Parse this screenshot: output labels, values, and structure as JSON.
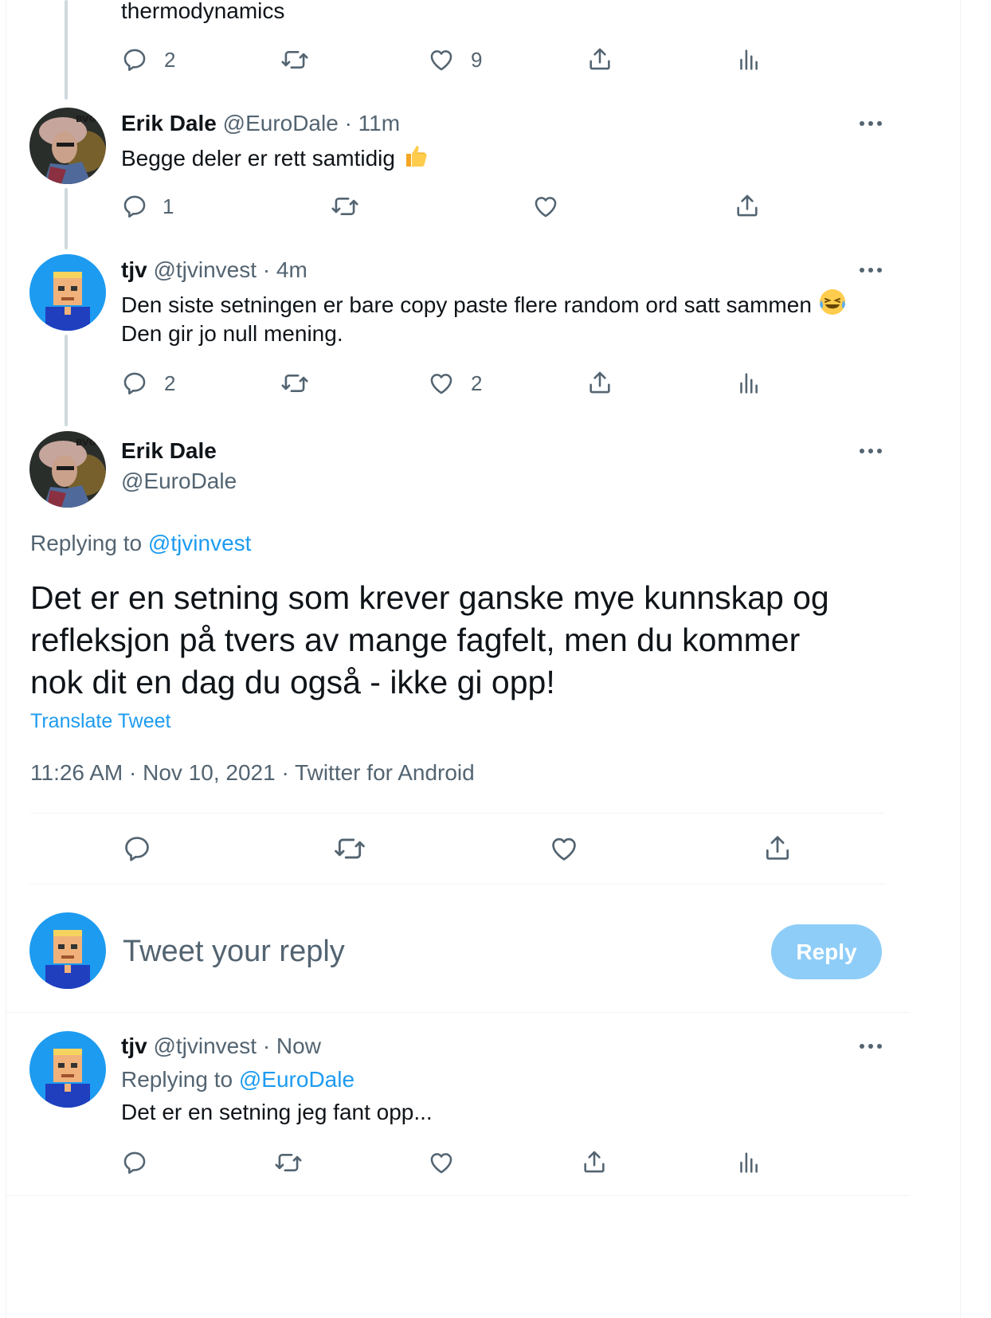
{
  "thread": {
    "prev_tweet": {
      "text_tail": "thermodynamics",
      "replies": "2",
      "likes": "9"
    },
    "tweet1": {
      "name": "Erik Dale",
      "handle": "@EuroDale",
      "time": "· 11m",
      "text": "Begge deler er rett samtidig",
      "replies": "1"
    },
    "tweet2": {
      "name": "tjv",
      "handle": "@tjvinvest",
      "time": "· 4m",
      "text_line1": "Den siste setningen er bare copy paste flere random ord satt sammen",
      "text_line2": "Den gir jo null mening.",
      "replies": "2",
      "likes": "2"
    }
  },
  "main_tweet": {
    "name": "Erik Dale",
    "handle": "@EuroDale",
    "replying_label": "Replying to",
    "replying_handle": "@tjvinvest",
    "text_line1": "Det er en setning som krever ganske mye kunnskap og",
    "text_line2": "refleksjon på tvers av mange fagfelt, men du kommer",
    "text_line3": "nok dit en dag du også - ikke gi opp!",
    "translate": "Translate Tweet",
    "meta": "11:26 AM · Nov 10, 2021 · Twitter for Android"
  },
  "composer": {
    "placeholder": "Tweet your reply",
    "button": "Reply"
  },
  "reply": {
    "name": "tjv",
    "handle": "@tjvinvest",
    "time": "· Now",
    "replying_label": "Replying to",
    "replying_handle": "@EuroDale",
    "text": "Det er en setning jeg fant opp..."
  },
  "colors": {
    "accent": "#1d9bf0",
    "reply_button_disabled": "#8ecdf8",
    "muted_text": "#536471",
    "thread_line": "#cfd9de"
  }
}
